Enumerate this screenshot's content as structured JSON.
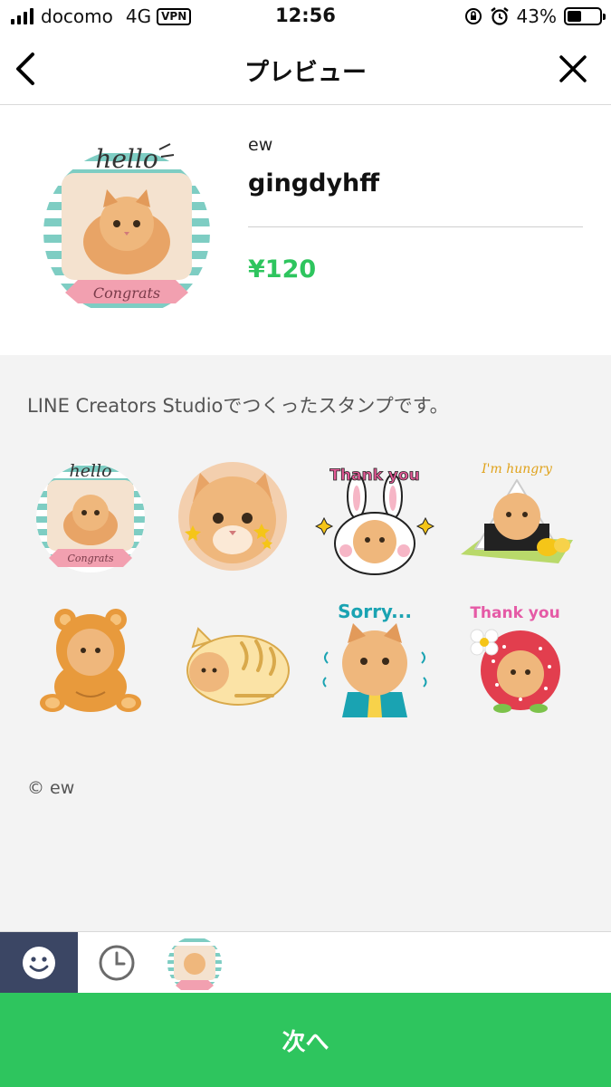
{
  "status_bar": {
    "carrier": "docomo",
    "network": "4G",
    "vpn": "VPN",
    "time": "12:56",
    "battery": "43%",
    "battery_level": 0.43
  },
  "nav": {
    "title": "プレビュー",
    "back_icon": "chevron-left-icon",
    "close_icon": "close-icon"
  },
  "product": {
    "author": "ew",
    "title": "gingdyhff",
    "price": "¥120",
    "main_sticker_text": {
      "top": "hello",
      "ribbon": "Congrats"
    }
  },
  "content": {
    "description": "LINE Creators Studioでつくったスタンプです。",
    "copyright": "© ew",
    "stickers": [
      {
        "kind": "hello-congrats",
        "top": "hello",
        "ribbon": "Congrats"
      },
      {
        "kind": "sparkle-face"
      },
      {
        "kind": "bunny-thank-you",
        "top": "Thank you"
      },
      {
        "kind": "onigiri-hungry",
        "top": "I'm hungry"
      },
      {
        "kind": "bear-costume"
      },
      {
        "kind": "tabby-cat"
      },
      {
        "kind": "sorry",
        "top": "Sorry..."
      },
      {
        "kind": "strawberry-thank-you",
        "top": "Thank you"
      }
    ]
  },
  "tabs": [
    "emoji-icon",
    "clock-icon",
    "sticker-pack-thumb"
  ],
  "next_button": {
    "label": "次へ"
  },
  "colors": {
    "accent_green": "#2ec55e",
    "active_tab": "#3b4664",
    "content_bg": "#f3f3f3",
    "stripe_teal": "#7ecdc3",
    "ribbon_pink": "#f2a0b0",
    "cat_orange": "#e8a466"
  }
}
